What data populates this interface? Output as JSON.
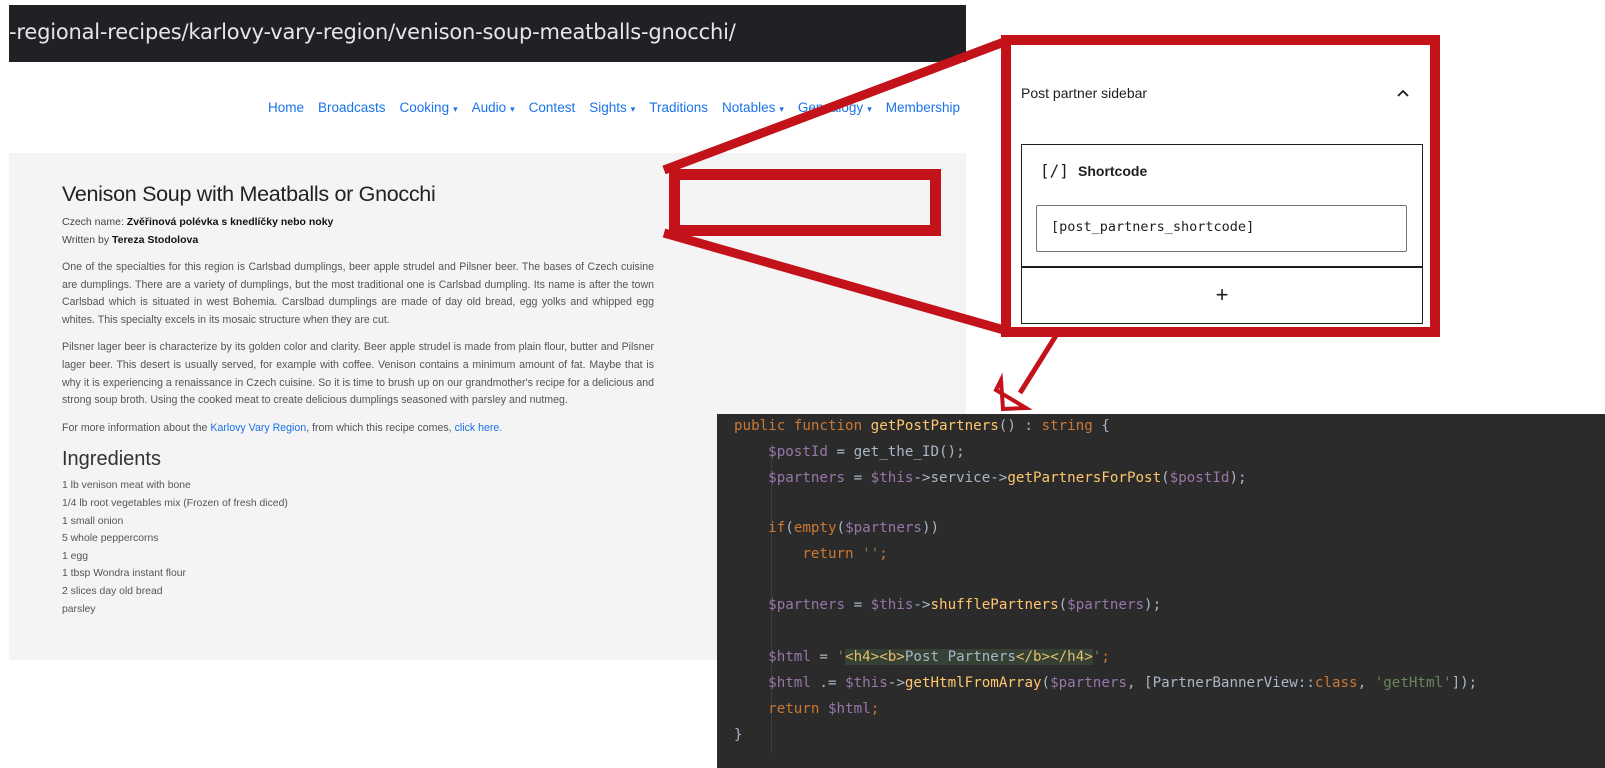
{
  "browser": {
    "url": "-regional-recipes/karlovy-vary-region/venison-soup-meatballs-gnocchi/"
  },
  "site": {
    "nav": [
      {
        "label": "Home",
        "dropdown": false
      },
      {
        "label": "Broadcasts",
        "dropdown": false
      },
      {
        "label": "Cooking",
        "dropdown": true
      },
      {
        "label": "Audio",
        "dropdown": true
      },
      {
        "label": "Contest",
        "dropdown": false
      },
      {
        "label": "Sights",
        "dropdown": true
      },
      {
        "label": "Traditions",
        "dropdown": false
      },
      {
        "label": "Notables",
        "dropdown": true
      },
      {
        "label": "Genealogy",
        "dropdown": true
      },
      {
        "label": "Membership",
        "dropdown": false
      }
    ],
    "article": {
      "title": "Venison Soup with Meatballs or Gnocchi",
      "czech_name_label": "Czech name:",
      "czech_name": "Zvěřinová polévka s knedlíčky nebo noky",
      "written_by_label": "Written by",
      "author": "Tereza Stodolova",
      "paragraph1": "One of the specialties for this region is Carlsbad dumplings, beer apple strudel and Pilsner beer. The bases of Czech cuisine are dumplings. There are a variety of dumplings, but the most traditional one is Carlsbad dumpling. Its name is after the town Carlsbad which is situated in west Bohemia. Carslbad dumplings are made of day old bread, egg yolks and whipped egg whites. This specialty excels in its mosaic structure when they are cut.",
      "paragraph2": "Pilsner lager beer is characterize by its golden color and clarity. Beer apple strudel is made from plain flour, butter and Pilsner lager beer. This desert is usually served, for example with coffee. Venison contains a minimum amount of fat. Maybe that is why it is experiencing a renaissance in Czech cuisine. So it is time to brush up on our grandmother's recipe for a delicious and strong soup broth. Using the cooked meat to create delicious dumplings seasoned with parsley and nutmeg.",
      "more_info_prefix": "For more information about the",
      "more_info_link": "Karlovy Vary Region",
      "more_info_middle": ", from which this recipe comes,",
      "click_here": "click here.",
      "ingredients_heading": "Ingredients",
      "ingredients": [
        "1 lb venison meat with bone",
        "1/4 lb root vegetables mix (Frozen of fresh diced)",
        "1 small onion",
        "5 whole peppercorns",
        "1 egg",
        "1 tbsp Wondra instant flour",
        "2 slices day old bread",
        "parsley"
      ]
    }
  },
  "panel": {
    "title": "Post partner sidebar",
    "chevron_icon": "chevron-up-icon",
    "block_icon_text": "[/]",
    "block_label": "Shortcode",
    "shortcode_value": "[post_partners_shortcode]",
    "add_block_symbol": "+"
  },
  "code": {
    "l1_kw": "public function ",
    "l1_fn": "getPostPartners",
    "l1_mid": "() : ",
    "l1_type": "string",
    "l1_end": " {",
    "l2_var": "$postId",
    "l2_mid": " = get_the_ID();",
    "l3_var": "$partners",
    "l3_a": " = ",
    "l3_this": "$this",
    "l3_b": "->service->",
    "l3_fn": "getPartnersForPost",
    "l3_c": "(",
    "l3_arg": "$postId",
    "l3_d": ");",
    "l5_a": "if",
    "l5_b": "(",
    "l5_kw": "empty",
    "l5_c": "(",
    "l5_var": "$partners",
    "l5_d": "))",
    "l6_kw": "return ",
    "l6_str": "''",
    "l6_end": ";",
    "l8_var": "$partners",
    "l8_a": " = ",
    "l8_this": "$this",
    "l8_b": "->",
    "l8_fn": "shufflePartners",
    "l8_c": "(",
    "l8_arg": "$partners",
    "l8_d": ");",
    "l10_var": "$html",
    "l10_a": " = ",
    "l10_q1": "'",
    "l10_tag1": "<h4><b>",
    "l10_text": "Post Partners",
    "l10_tag2": "</b></h4>",
    "l10_q2": "'",
    "l10_end": ";",
    "l11_var": "$html",
    "l11_a": " .= ",
    "l11_this": "$this",
    "l11_b": "->",
    "l11_fn": "getHtmlFromArray",
    "l11_c": "(",
    "l11_arg": "$partners",
    "l11_d": ", [PartnerBannerView::",
    "l11_kw": "class",
    "l11_e": ", ",
    "l11_str": "'getHtml'",
    "l11_f": "]);",
    "l12_kw": "return ",
    "l12_var": "$html",
    "l12_end": ";",
    "l13": "}"
  },
  "colors": {
    "callout_red": "#c4121b",
    "code_background": "#2b2b2b",
    "link_blue": "#1a73e8"
  }
}
